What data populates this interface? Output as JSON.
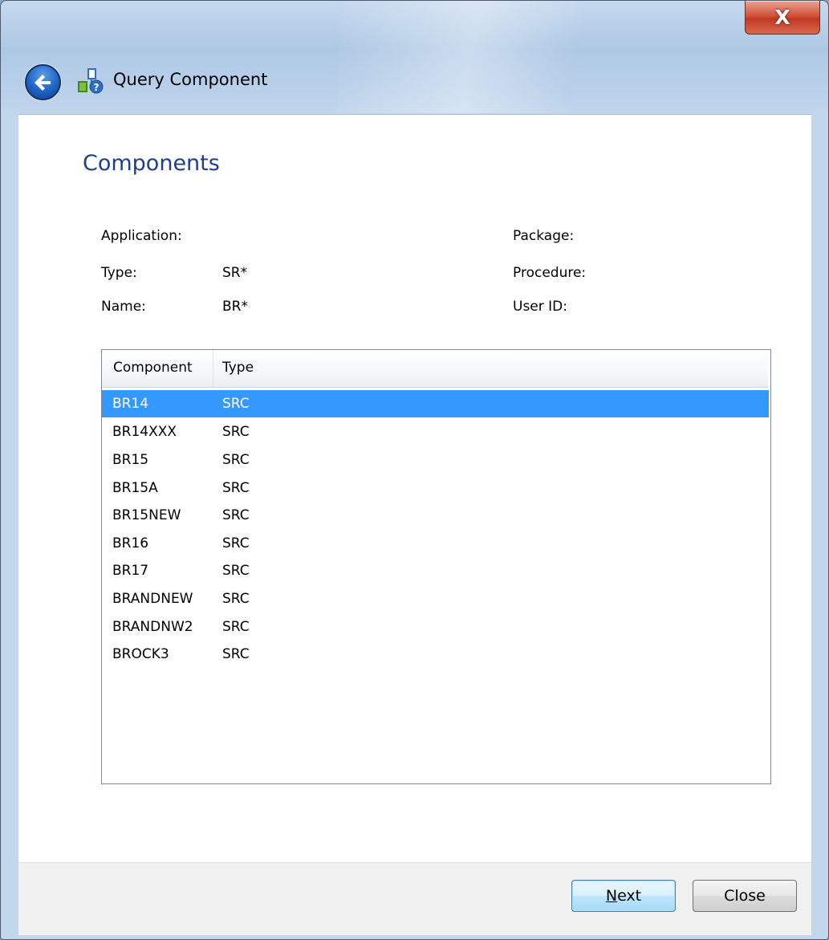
{
  "window": {
    "title": "Query Component",
    "close_glyph": "X"
  },
  "heading": "Components",
  "info": {
    "left": [
      {
        "label": "Application:",
        "value": ""
      },
      {
        "label": "Type:",
        "value": "SR*"
      },
      {
        "label": "Name:",
        "value": "BR*"
      }
    ],
    "right": [
      {
        "label": "Package:",
        "value": ""
      },
      {
        "label": "Procedure:",
        "value": ""
      },
      {
        "label": "User ID:",
        "value": ""
      }
    ]
  },
  "list": {
    "columns": [
      "Component",
      "Type"
    ],
    "rows": [
      {
        "component": "BR14",
        "type": "SRC",
        "selected": true
      },
      {
        "component": "BR14XXX",
        "type": "SRC",
        "selected": false
      },
      {
        "component": "BR15",
        "type": "SRC",
        "selected": false
      },
      {
        "component": "BR15A",
        "type": "SRC",
        "selected": false
      },
      {
        "component": "BR15NEW",
        "type": "SRC",
        "selected": false
      },
      {
        "component": "BR16",
        "type": "SRC",
        "selected": false
      },
      {
        "component": "BR17",
        "type": "SRC",
        "selected": false
      },
      {
        "component": "BRANDNEW",
        "type": "SRC",
        "selected": false
      },
      {
        "component": "BRANDNW2",
        "type": "SRC",
        "selected": false
      },
      {
        "component": "BROCK3",
        "type": "SRC",
        "selected": false
      }
    ]
  },
  "buttons": {
    "next_access_key": "N",
    "next_rest": "ext",
    "close": "Close"
  },
  "icons": {
    "back": "back-arrow-icon",
    "title": "query-component-icon",
    "close": "close-icon"
  },
  "colors": {
    "heading": "#1e3f8f",
    "selection": "#3399ff"
  }
}
